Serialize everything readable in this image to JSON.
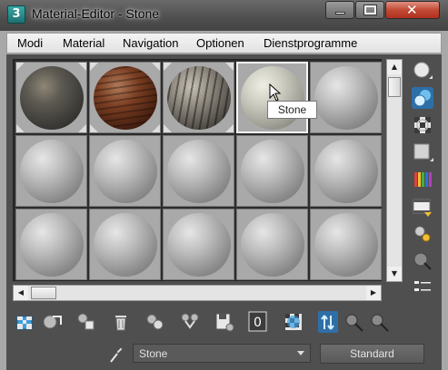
{
  "window": {
    "title": "Material-Editor - Stone",
    "app_icon_text": "3",
    "close_glyph": "✕"
  },
  "menu": {
    "items": [
      "Modi",
      "Material",
      "Navigation",
      "Optionen",
      "Dienstprogramme"
    ]
  },
  "slots": {
    "rows": 3,
    "columns": 5,
    "materials": [
      "granite",
      "rusted-wood",
      "weathered-planks",
      "Stone",
      "default-gray"
    ],
    "selected_index": 3
  },
  "tooltip": {
    "text": "Stone"
  },
  "toolbar": {
    "material_id_value": "0"
  },
  "material_name": {
    "value": "Stone"
  },
  "material_type": {
    "label": "Standard"
  },
  "icons": {
    "side": [
      "sample-type-icon",
      "backlight-icon",
      "background-icon",
      "tiling-icon",
      "video-color-check-icon",
      "make-preview-icon",
      "options-icon",
      "select-by-material-icon",
      "material-map-navigator-icon"
    ],
    "bottom": [
      "get-material-icon",
      "put-to-scene-icon",
      "assign-material-icon",
      "reset-map-icon",
      "make-unique-icon",
      "copy-material-icon",
      "put-to-library-icon",
      "material-id-icon",
      "show-shaded-icon",
      "show-end-result-icon",
      "go-to-parent-icon",
      "go-forward-icon"
    ],
    "eyedropper": "eyedropper-icon"
  },
  "colors": {
    "panel": "#4f4f4f",
    "slot_bg": "#a9a9a9",
    "selected_border": "#f4f4f4",
    "accent_blue": "#3a9de0"
  }
}
